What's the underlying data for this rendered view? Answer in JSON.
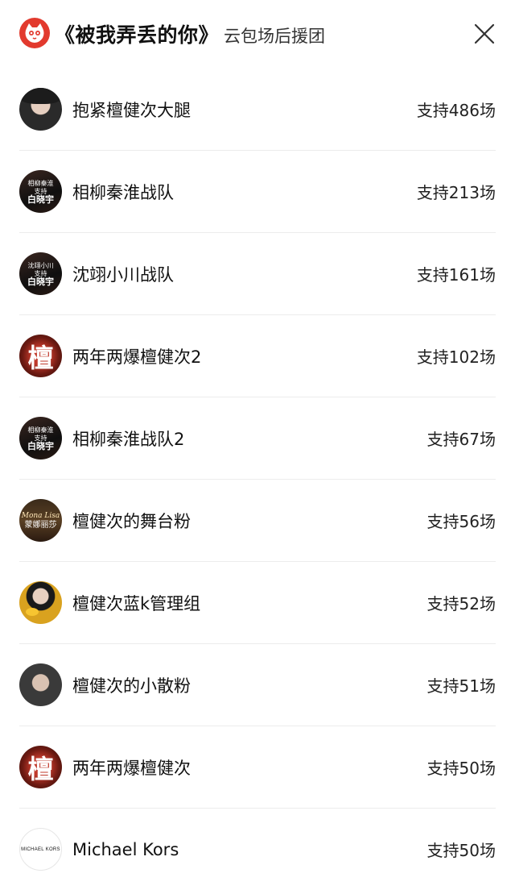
{
  "header": {
    "title": "《被我弄丢的你》",
    "subtitle": "云包场后援团"
  },
  "support_prefix": "支持",
  "support_suffix": "场",
  "rows": [
    {
      "name": "抱紧檀健次大腿",
      "support": "支持486场",
      "avatar": "photo"
    },
    {
      "name": "相柳秦淮战队",
      "support": "支持213场",
      "avatar": "dark-text",
      "avatar_lines": [
        "相柳秦淮",
        "支持",
        "白晓宇"
      ]
    },
    {
      "name": "沈翊小川战队",
      "support": "支持161场",
      "avatar": "dark-text",
      "avatar_lines": [
        "沈翊小川",
        "支持",
        "白晓宇"
      ]
    },
    {
      "name": "两年两爆檀健次2",
      "support": "支持102场",
      "avatar": "tan",
      "avatar_char": "檀"
    },
    {
      "name": "相柳秦淮战队2",
      "support": "支持67场",
      "avatar": "dark-text",
      "avatar_lines": [
        "相柳秦淮",
        "支持",
        "白晓宇"
      ]
    },
    {
      "name": "檀健次的舞台粉",
      "support": "支持56场",
      "avatar": "mona",
      "avatar_lines": [
        "Mona Lisa",
        "蒙娜丽莎"
      ]
    },
    {
      "name": "檀健次蓝k管理组",
      "support": "支持52场",
      "avatar": "yellow"
    },
    {
      "name": "檀健次的小散粉",
      "support": "支持51场",
      "avatar": "grey"
    },
    {
      "name": "两年两爆檀健次",
      "support": "支持50场",
      "avatar": "tan",
      "avatar_char": "檀"
    },
    {
      "name": "Michael Kors",
      "support": "支持50场",
      "avatar": "mk",
      "avatar_text": "MICHAEL KORS"
    }
  ],
  "icons": {
    "logo": "cat-logo-icon",
    "close": "close-icon"
  },
  "colors": {
    "logo_red": "#e23a2e",
    "divider": "#ececec"
  }
}
